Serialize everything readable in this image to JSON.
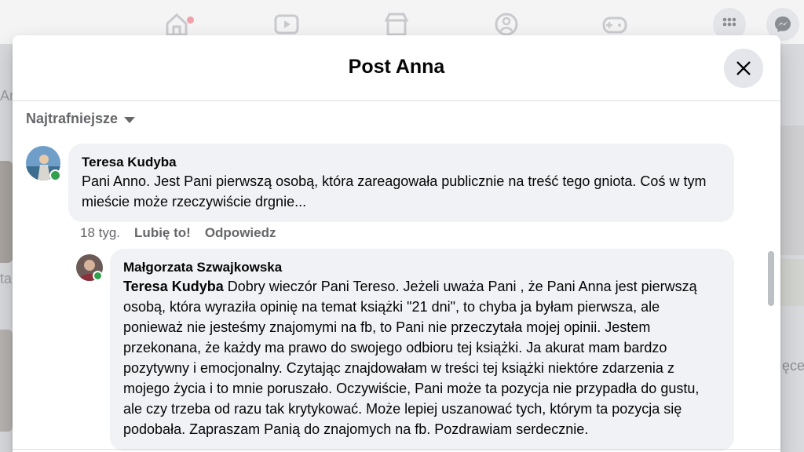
{
  "colors": {
    "accent": "#1877f2",
    "online": "#31a24c",
    "muted": "#65676b",
    "bubble": "#f0f2f5"
  },
  "background": {
    "left_letters_1": "An",
    "left_letters_2": "ta",
    "right_text": "ęce"
  },
  "modal": {
    "title": "Post Anna",
    "close_icon": "close-icon"
  },
  "sort": {
    "label": "Najtrafniejsze"
  },
  "comments": [
    {
      "author": "Teresa Kudyba",
      "text": "Pani Anno. Jest Pani pierwszą osobą, która zareagowała publicznie na treść tego gniota. Coś w tym mieście może rzeczywiście drgnie...",
      "time": "18 tyg.",
      "like_label": "Lubię to!",
      "reply_label": "Odpowiedz"
    },
    {
      "author": "Małgorzata Szwajkowska",
      "mention": "Teresa Kudyba",
      "text": " Dobry wieczór Pani Tereso. Jeżeli uważa Pani , że Pani Anna jest pierwszą osobą, która wyraziła opinię na temat książki \"21 dni\", to chyba ja byłam pierwsza, ale ponieważ nie jesteśmy znajomymi na fb, to Pani nie przeczytała mojej opinii. Jestem przekonana, że każdy ma prawo do swojego odbioru tej książki. Ja akurat mam bardzo pozytywny i emocjonalny. Czytając znajdowałam w treści tej książki niektóre zdarzenia z mojego życia i to mnie poruszało. Oczywiście, Pani może ta pozycja nie przypadła do gustu, ale czy trzeba od razu tak krytykować. Może lepiej uszanować tych, którym ta pozycja się podobała. Zapraszam Panią do znajomych na fb. Pozdrawiam serdecznie."
    }
  ]
}
